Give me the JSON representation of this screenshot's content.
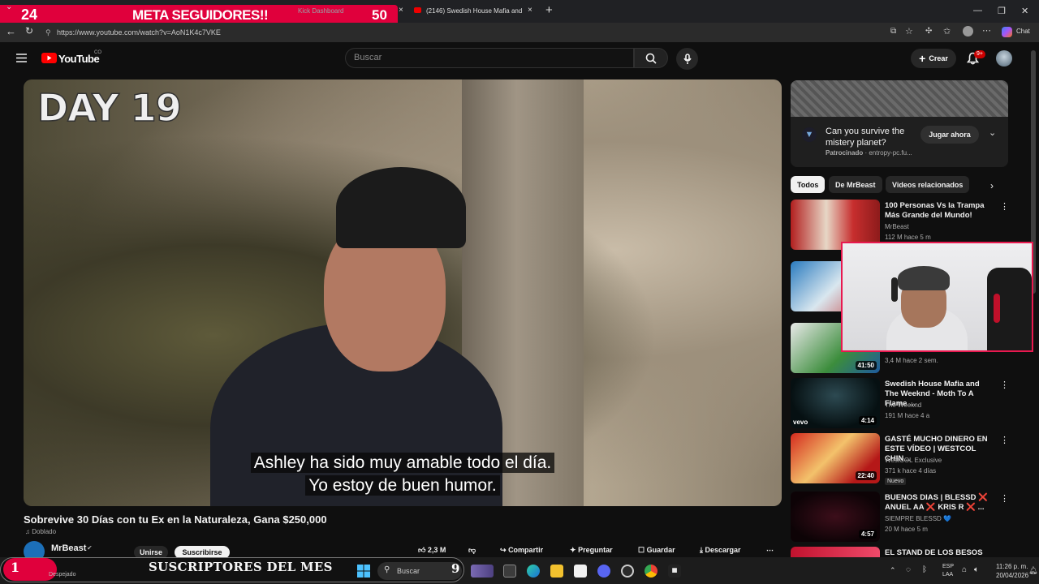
{
  "stream_overlay": {
    "followers_current": "24",
    "followers_goal_label": "META SEGUIDORES!!",
    "followers_target": "50",
    "subs_count": "1",
    "subs_label": "SUSCRIPTORES DEL MES",
    "accent": "#e0003c"
  },
  "browser": {
    "tabs": [
      {
        "label": "Kick Dashboard"
      },
      {
        "label": "(2146) Swedish House Mafia and"
      }
    ],
    "url": "https://www.youtube.com/watch?v=AoN1K4c7VKE",
    "copilot_label": "Chat"
  },
  "youtube": {
    "logo": "YouTube",
    "logo_region": "CO",
    "search_placeholder": "Buscar",
    "create_label": "Crear",
    "notif_count": "9+"
  },
  "player": {
    "overlay_text": "DAY 19",
    "subtitle_line1": "Ashley ha sido muy amable todo el día.",
    "subtitle_line2": "Yo estoy de buen humor."
  },
  "video": {
    "title": "Sobrevive 30 Días con tu Ex en la Naturaleza, Gana $250,000",
    "dubbed_label": "Doblado",
    "channel": "MrBeast",
    "join_label": "Unirse",
    "subscribe_label": "Suscribirse",
    "likes": "2,3 M",
    "share_label": "Compartir",
    "ask_label": "Preguntar",
    "save_label": "Guardar",
    "download_label": "Descargar"
  },
  "ad": {
    "title": "Can you survive the mistery planet?",
    "sponsored_label": "Patrocinado",
    "domain": "entropy-pc.fu...",
    "cta": "Jugar ahora"
  },
  "chips": [
    "Todos",
    "De MrBeast",
    "Videos relacionados"
  ],
  "recommendations": [
    {
      "title": "100 Personas Vs la Trampa Más Grande del Mundo!",
      "channel": "MrBeast",
      "stats": "112 M  hace 5 m",
      "duration": ""
    },
    {
      "title": "",
      "channel": "",
      "stats": "",
      "duration": ""
    },
    {
      "title": "",
      "channel": "",
      "stats": "3,4 M  hace 2 sem.",
      "duration": "41:50"
    },
    {
      "title": "Swedish House Mafia and The Weeknd - Moth To A Flame ...",
      "channel": "The Weeknd",
      "stats": "191 M  hace 4 a",
      "duration": "4:14"
    },
    {
      "title": "GASTÉ MUCHO DINERO EN ESTE VÍDEO | WESTCOL CHIN...",
      "channel": "WestCOL Exclusive",
      "stats": "371 k  hace 4 días",
      "duration": "22:40",
      "badge": "Nuevo"
    },
    {
      "title": "BUENOS DIAS | BLESSD ❌ ANUEL AA ❌ KRIS R ❌ ...",
      "channel": "SIEMPRE BLESSD 💙",
      "stats": "20 M  hace 5 m",
      "duration": "4:57"
    },
    {
      "title": "EL STAND DE LOS BESOS 💋",
      "channel": "",
      "stats": "",
      "duration": ""
    }
  ],
  "taskbar": {
    "weather": "Despejado",
    "search_placeholder": "Buscar",
    "lang_line1": "ESP",
    "lang_line2": "LAA",
    "time": "11:26 p. m.",
    "date": "20/04/2026"
  }
}
